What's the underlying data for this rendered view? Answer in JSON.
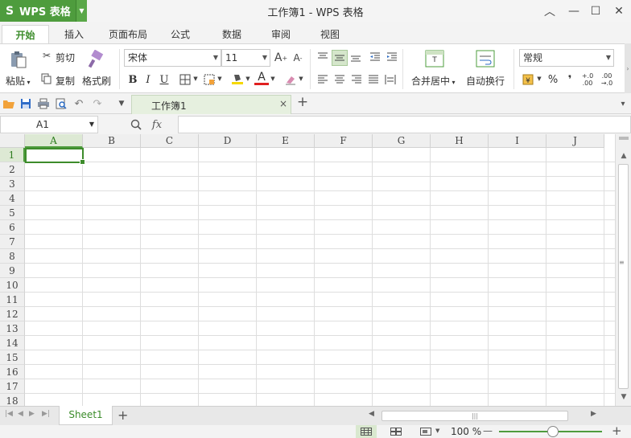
{
  "app": {
    "button_logo": "S",
    "button_name": "WPS 表格",
    "window_title": "工作簿1 - WPS 表格",
    "brand_color": "#4e9c3d"
  },
  "window_controls": {
    "collapse": "︿",
    "skin": "☐",
    "minimize": "—",
    "maximize": "☐",
    "close": "✕"
  },
  "menu_tabs": [
    "开始",
    "插入",
    "页面布局",
    "公式",
    "数据",
    "审阅",
    "视图"
  ],
  "ribbon": {
    "paste": "粘贴",
    "cut": "剪切",
    "copy": "复制",
    "format_painter": "格式刷",
    "font_name": "宋体",
    "font_size": "11",
    "bold": "B",
    "italic": "I",
    "underline": "U",
    "font_color_letter": "A",
    "merge_center": "合并居中",
    "wrap_text": "自动换行",
    "number_format": "常规",
    "percent": "%",
    "thousands": "❜",
    "inc_decimal": "+.0\n.00",
    "dec_decimal": ".00\n→.0"
  },
  "document_tab": {
    "title": "工作簿1",
    "close": "×",
    "add": "+"
  },
  "formula_bar": {
    "name_box": "A1",
    "fx": "fx",
    "value": ""
  },
  "grid": {
    "columns": [
      "A",
      "B",
      "C",
      "D",
      "E",
      "F",
      "G",
      "H",
      "I",
      "J"
    ],
    "rows": [
      "1",
      "2",
      "3",
      "4",
      "5",
      "6",
      "7",
      "8",
      "9",
      "10",
      "11",
      "12",
      "13",
      "14",
      "15",
      "16",
      "17",
      "18"
    ],
    "active_cell": "A1"
  },
  "sheets": {
    "tabs": [
      "Sheet1"
    ],
    "add": "+"
  },
  "status": {
    "zoom": "100 %",
    "zoom_out": "—",
    "zoom_in": "+"
  }
}
